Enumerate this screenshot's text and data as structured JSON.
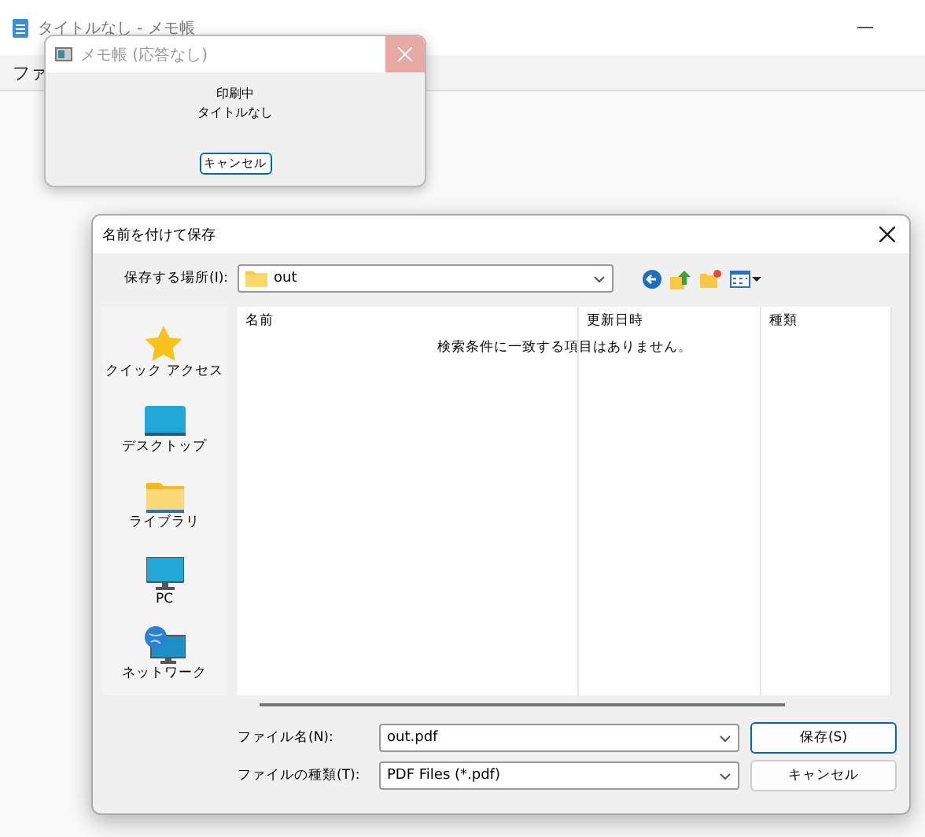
{
  "app_window": {
    "title": "タイトルなし - メモ帳",
    "menu": [
      "ファ"
    ]
  },
  "print_dialog": {
    "title": "メモ帳 (応答なし)",
    "lines": [
      "印刷中",
      "タイトルなし"
    ],
    "button": "キャンセル"
  },
  "save_dialog": {
    "title": "名前を付けて保存",
    "location_label": "保存する場所(I):",
    "location": "out",
    "places": [
      {
        "kind": "star",
        "label": "クイック アクセス"
      },
      {
        "kind": "desktop",
        "label": "デスクトップ"
      },
      {
        "kind": "folder",
        "label": "ライブラリ"
      },
      {
        "kind": "pc",
        "label": "PC"
      },
      {
        "kind": "network",
        "label": "ネットワーク"
      }
    ],
    "columns": [
      "名前",
      "更新日時",
      "種類"
    ],
    "empty_message": "検索条件に一致する項目はありません。",
    "filename_label": "ファイル名(N):",
    "filename": "out.pdf",
    "filetype_label": "ファイルの種類(T):",
    "filetype": "PDF Files (*.pdf)",
    "buttons": [
      {
        "label": "保存(S)",
        "selected": true
      },
      {
        "label": "キャンセル",
        "selected": false
      }
    ]
  }
}
